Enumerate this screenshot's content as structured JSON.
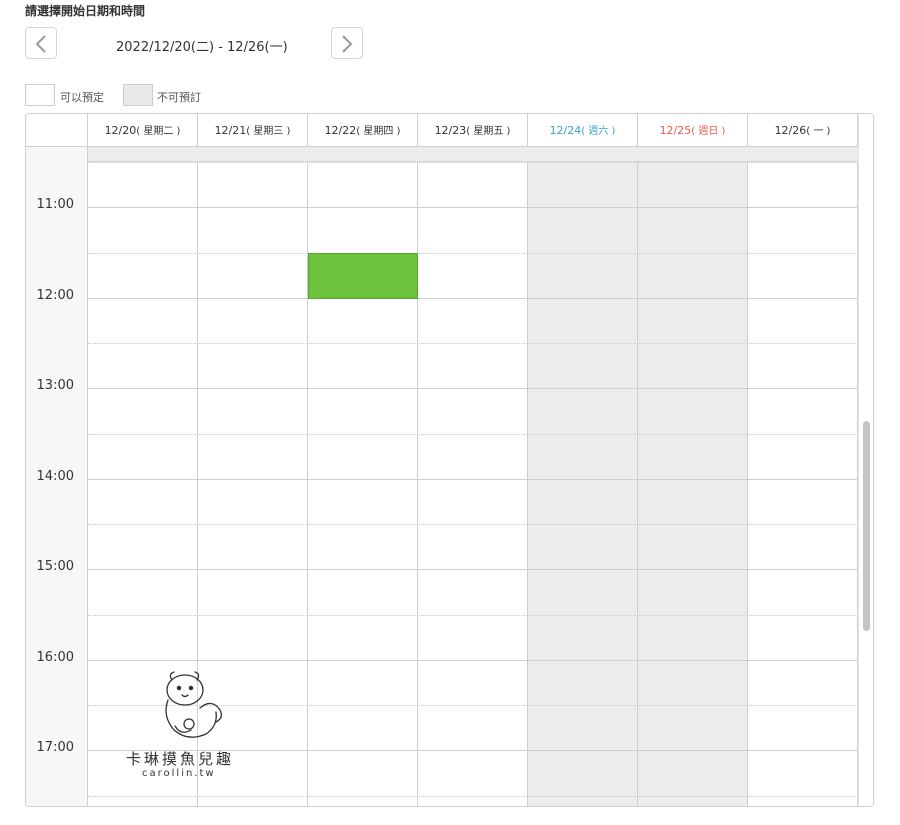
{
  "title": "請選擇開始日期和時間",
  "date_range": "2022/12/20(二) - 12/26(一)",
  "legend": {
    "available": "可以預定",
    "unavailable": "不可預訂"
  },
  "days": [
    {
      "date": "12/20",
      "weekday": "( 星期二 )",
      "type": "weekday"
    },
    {
      "date": "12/21",
      "weekday": "( 星期三 )",
      "type": "weekday"
    },
    {
      "date": "12/22",
      "weekday": "( 星期四 )",
      "type": "weekday"
    },
    {
      "date": "12/23",
      "weekday": "( 星期五 )",
      "type": "weekday"
    },
    {
      "date": "12/24",
      "weekday": "( 週六 )",
      "type": "saturday"
    },
    {
      "date": "12/25",
      "weekday": "( 週日 )",
      "type": "sunday"
    },
    {
      "date": "12/26",
      "weekday": "( 一 )",
      "type": "weekday"
    }
  ],
  "times": [
    "11:00",
    "12:00",
    "13:00",
    "14:00",
    "15:00",
    "16:00",
    "17:00"
  ],
  "colors": {
    "booked": "#6cc23a",
    "saturday": "#3aa0c8",
    "sunday": "#e85a4a",
    "unavailable": "#ececec"
  },
  "watermark": {
    "text": "卡琳摸魚兒趣",
    "url": "carollin.tw"
  }
}
